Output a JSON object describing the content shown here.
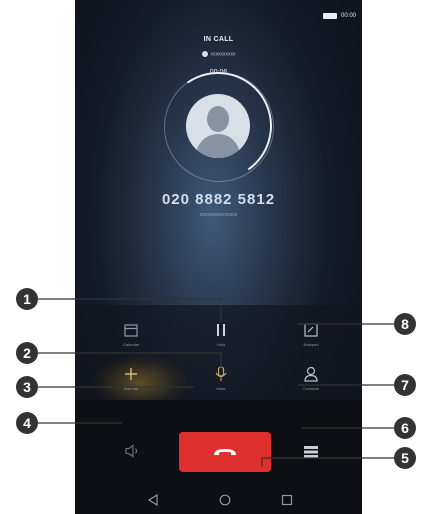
{
  "status_bar": {
    "time": "00:00"
  },
  "call": {
    "status": "IN CALL",
    "sim": "xxxxxxxxxx",
    "timer": "00:06",
    "number": "020 8882 5812",
    "location": "xxxxxxxxxxxxxxx"
  },
  "controls": {
    "calendar_label": "Calendar",
    "hold_label": "Hold",
    "notepad_label": "Notepad",
    "add_call_label": "Add call",
    "mute_label": "Mute",
    "contacts_label": "Contacts"
  },
  "callouts": [
    "1",
    "2",
    "3",
    "4",
    "5",
    "6",
    "7",
    "8"
  ],
  "colors": {
    "end_button": "#e02f2f",
    "callout": "#333333"
  },
  "icons": [
    "calendar-icon",
    "pause-icon",
    "notepad-icon",
    "plus-icon",
    "microphone-icon",
    "contact-icon",
    "speaker-icon",
    "dialpad-icon",
    "end-call-icon",
    "back-icon",
    "home-icon",
    "recents-icon"
  ]
}
